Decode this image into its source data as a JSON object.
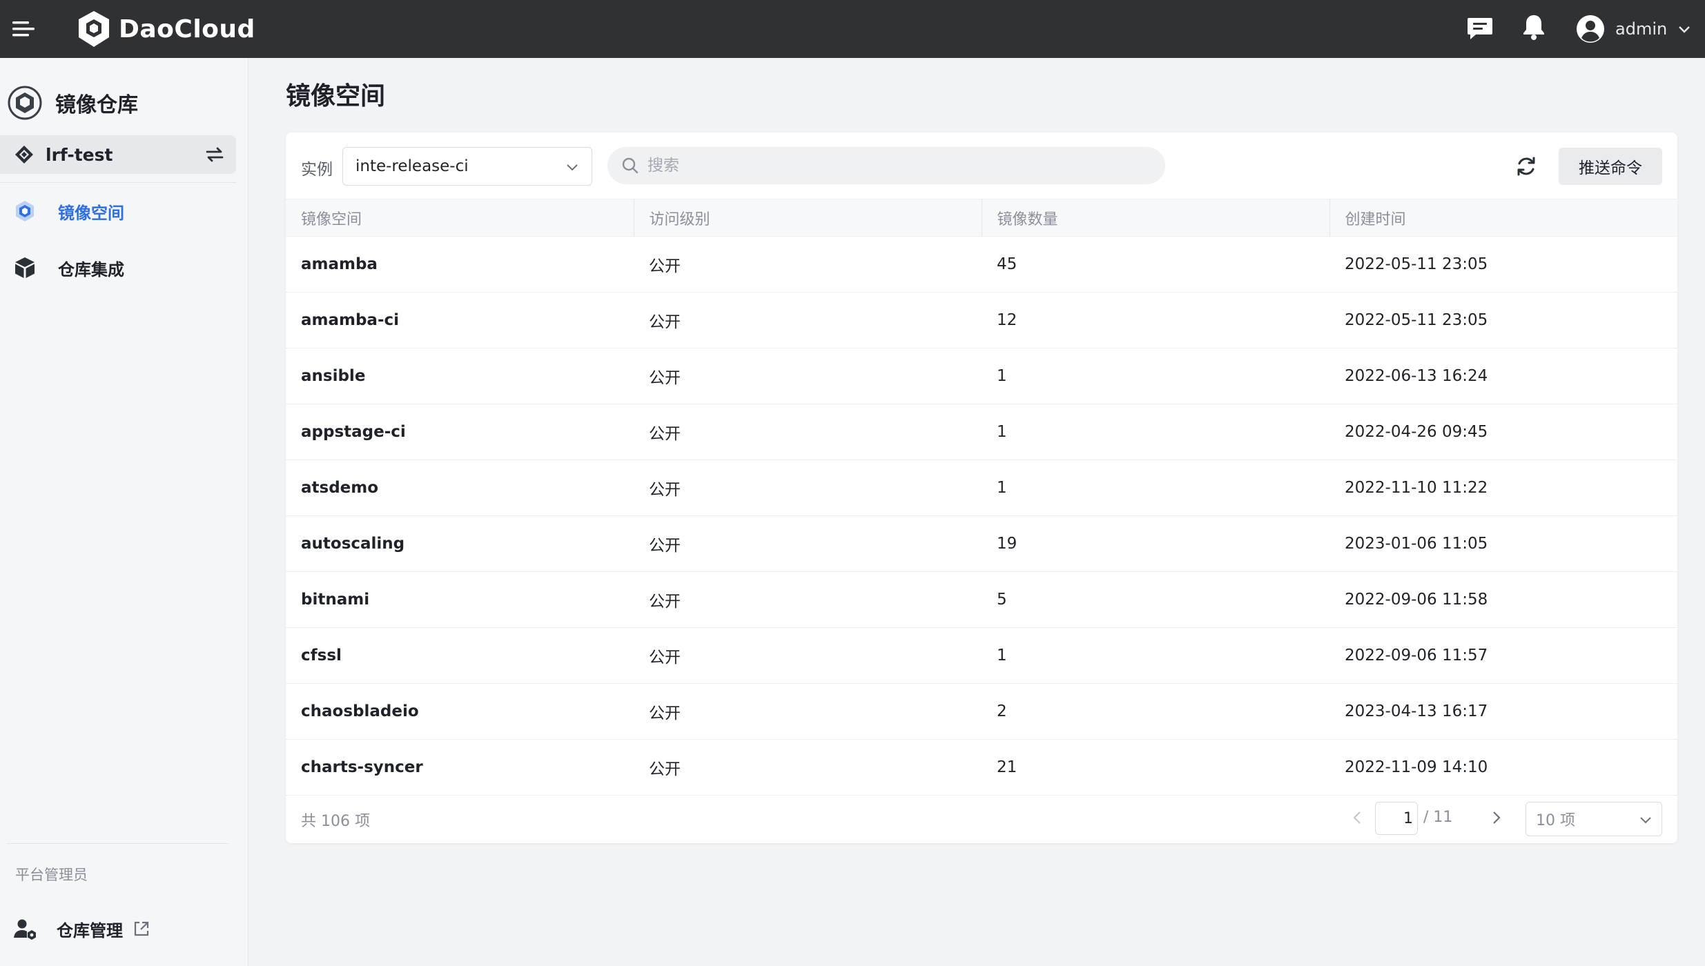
{
  "topbar": {
    "brand": "DaoCloud",
    "username": "admin"
  },
  "sidebar": {
    "module_title": "镜像仓库",
    "workspace": "lrf-test",
    "nav": [
      {
        "label": "镜像空间",
        "active": true
      },
      {
        "label": "仓库集成",
        "active": false
      }
    ],
    "section_label": "平台管理员",
    "admin_item": "仓库管理"
  },
  "main": {
    "title": "镜像空间",
    "toolbar": {
      "instance_label": "实例",
      "instance_value": "inte-release-ci",
      "search_placeholder": "搜索",
      "push_button": "推送命令"
    },
    "columns": [
      "镜像空间",
      "访问级别",
      "镜像数量",
      "创建时间"
    ],
    "rows": [
      {
        "name": "amamba",
        "access": "公开",
        "count": "45",
        "created": "2022-05-11 23:05"
      },
      {
        "name": "amamba-ci",
        "access": "公开",
        "count": "12",
        "created": "2022-05-11 23:05"
      },
      {
        "name": "ansible",
        "access": "公开",
        "count": "1",
        "created": "2022-06-13 16:24"
      },
      {
        "name": "appstage-ci",
        "access": "公开",
        "count": "1",
        "created": "2022-04-26 09:45"
      },
      {
        "name": "atsdemo",
        "access": "公开",
        "count": "1",
        "created": "2022-11-10 11:22"
      },
      {
        "name": "autoscaling",
        "access": "公开",
        "count": "19",
        "created": "2023-01-06 11:05"
      },
      {
        "name": "bitnami",
        "access": "公开",
        "count": "5",
        "created": "2022-09-06 11:58"
      },
      {
        "name": "cfssl",
        "access": "公开",
        "count": "1",
        "created": "2022-09-06 11:57"
      },
      {
        "name": "chaosbladeio",
        "access": "公开",
        "count": "2",
        "created": "2023-04-13 16:17"
      },
      {
        "name": "charts-syncer",
        "access": "公开",
        "count": "21",
        "created": "2022-11-09 14:10"
      }
    ],
    "pagination": {
      "total_text": "共 106 项",
      "current_page": "1",
      "total_pages_text": "/ 11",
      "page_size": "10 项"
    }
  },
  "colors": {
    "topbar": "#303134",
    "accent": "#2f6fe4",
    "sidebar_bg": "#f5f6f8"
  },
  "icons": [
    "menu-icon",
    "daocloud-logo-icon",
    "message-icon",
    "bell-icon",
    "user-avatar-icon",
    "chevron-down-icon",
    "registry-module-icon",
    "workspace-icon",
    "switch-icon",
    "image-space-icon",
    "repo-integration-icon",
    "admin-user-icon",
    "external-link-icon",
    "search-icon",
    "refresh-icon",
    "chevron-left-icon",
    "chevron-right-icon"
  ]
}
